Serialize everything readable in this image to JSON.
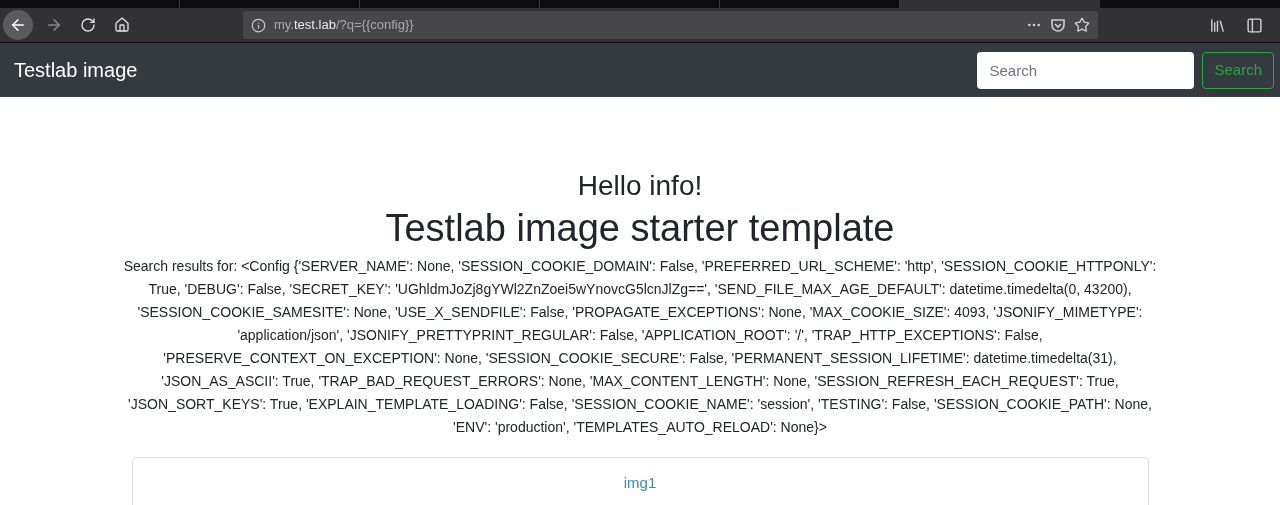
{
  "browser": {
    "url": "my.**test.lab**/?q={{config}}"
  },
  "navbar": {
    "brand": "Testlab image",
    "search": {
      "placeholder": "Search"
    },
    "search_button": "Search"
  },
  "main": {
    "greeting": "Hello info!",
    "title": "Testlab image starter template",
    "results": "Search results for: <Config {'SERVER_NAME': None, 'SESSION_COOKIE_DOMAIN': False, 'PREFERRED_URL_SCHEME': 'http', 'SESSION_COOKIE_HTTPONLY': True, 'DEBUG': False, 'SECRET_KEY': 'UGhldmJoZj8gYWl2ZnZoei5wYnovcG5lcnJlZg==', 'SEND_FILE_MAX_AGE_DEFAULT': datetime.timedelta(0, 43200), 'SESSION_COOKIE_SAMESITE': None, 'USE_X_SENDFILE': False, 'PROPAGATE_EXCEPTIONS': None, 'MAX_COOKIE_SIZE': 4093, 'JSONIFY_MIMETYPE': 'application/json', 'JSONIFY_PRETTYPRINT_REGULAR': False, 'APPLICATION_ROOT': '/', 'TRAP_HTTP_EXCEPTIONS': False, 'PRESERVE_CONTEXT_ON_EXCEPTION': None, 'SESSION_COOKIE_SECURE': False, 'PERMANENT_SESSION_LIFETIME': datetime.timedelta(31), 'JSON_AS_ASCII': True, 'TRAP_BAD_REQUEST_ERRORS': None, 'MAX_CONTENT_LENGTH': None, 'SESSION_REFRESH_EACH_REQUEST': True, 'JSON_SORT_KEYS': True, 'EXPLAIN_TEMPLATE_LOADING': False, 'SESSION_COOKIE_NAME': 'session', 'TESTING': False, 'SESSION_COOKIE_PATH': None, 'ENV': 'production', 'TEMPLATES_AUTO_RELOAD': None}>",
    "cards": [
      {
        "link": "img1"
      }
    ]
  }
}
